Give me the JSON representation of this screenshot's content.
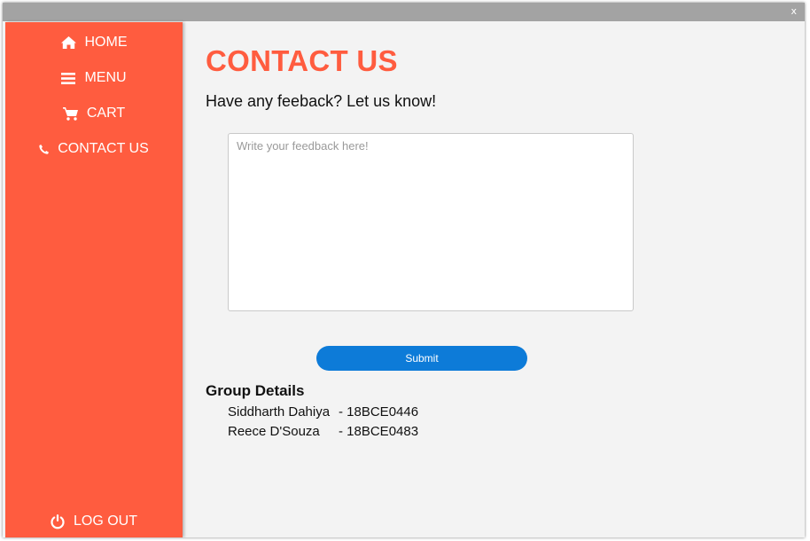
{
  "window": {
    "close_label": "x"
  },
  "sidebar": {
    "items": [
      {
        "label": "HOME",
        "icon": "home-icon"
      },
      {
        "label": "MENU",
        "icon": "menu-icon"
      },
      {
        "label": "CART",
        "icon": "cart-icon"
      },
      {
        "label": "CONTACT US",
        "icon": "phone-icon"
      }
    ],
    "logout": {
      "label": "LOG OUT",
      "icon": "power-icon"
    },
    "color": "#ff5c3f"
  },
  "main": {
    "title": "CONTACT US",
    "subtitle": "Have any feeback? Let us know!",
    "feedback": {
      "placeholder": "Write your feedback here!",
      "value": ""
    },
    "submit_label": "Submit",
    "submit_color": "#0d7bd8",
    "group": {
      "title": "Group Details",
      "members": [
        {
          "name": "Siddharth Dahiya",
          "id": "- 18BCE0446"
        },
        {
          "name": "Reece D'Souza",
          "id": "- 18BCE0483"
        }
      ]
    }
  }
}
